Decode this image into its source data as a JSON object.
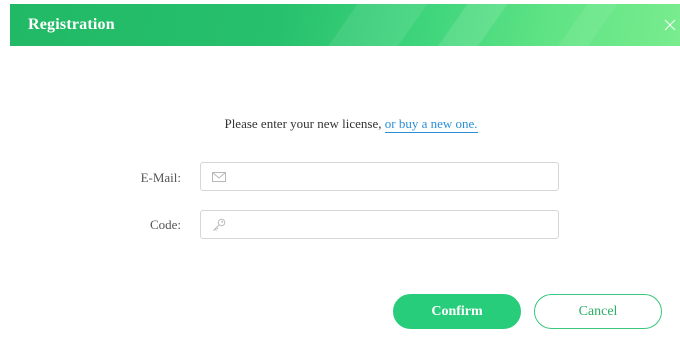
{
  "dialog": {
    "title": "Registration",
    "prompt_text": "Please enter your new license, ",
    "buy_link": "or buy a new one.",
    "email_label": "E-Mail:",
    "email_value": "",
    "code_label": "Code:",
    "code_value": "",
    "confirm_label": "Confirm",
    "cancel_label": "Cancel"
  },
  "icons": {
    "close": "close-icon",
    "email": "envelope-icon",
    "code": "key-icon"
  },
  "colors": {
    "header_start": "#21b966",
    "header_end": "#79ec8e",
    "accent": "#28cd7b",
    "link": "#2a8fd6"
  }
}
